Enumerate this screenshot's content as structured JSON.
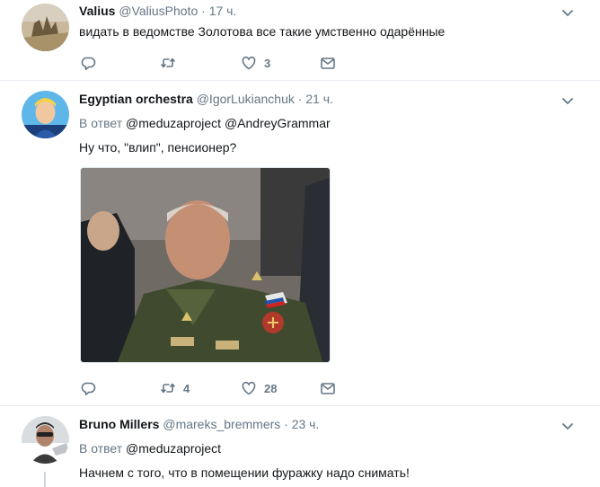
{
  "tweets": [
    {
      "name": "Valius",
      "handle": "@ValiusPhoto",
      "time": "17 ч.",
      "text": "видать в ведомстве Золотова все такие умственно одарённые",
      "actions": {
        "reply_count": "",
        "retweet_count": "",
        "like_count": "3"
      }
    },
    {
      "name": "Egyptian orchestra",
      "handle": "@IgorLukianchuk",
      "time": "21 ч.",
      "reply_prefix": "В ответ",
      "reply_mentions": "@meduzaproject @AndreyGrammar",
      "text": "Ну что, \"влип\", пенсионер?",
      "actions": {
        "reply_count": "",
        "retweet_count": "4",
        "like_count": "28"
      }
    },
    {
      "name": "Bruno Millers",
      "handle": "@mareks_bremmers",
      "time": "23 ч.",
      "reply_prefix": "В ответ",
      "reply_mentions": "@meduzaproject",
      "text": "Начнем с того, что в помещении фуражку надо снимать!"
    }
  ],
  "separator": "·",
  "icons": {
    "reply": "reply-icon",
    "retweet": "retweet-icon",
    "like": "heart-icon",
    "message": "message-icon",
    "caret": "chevron-down-icon"
  },
  "colors": {
    "secondary_text": "#657786",
    "primary_text": "#14171a",
    "divider": "#e6ecf0"
  }
}
